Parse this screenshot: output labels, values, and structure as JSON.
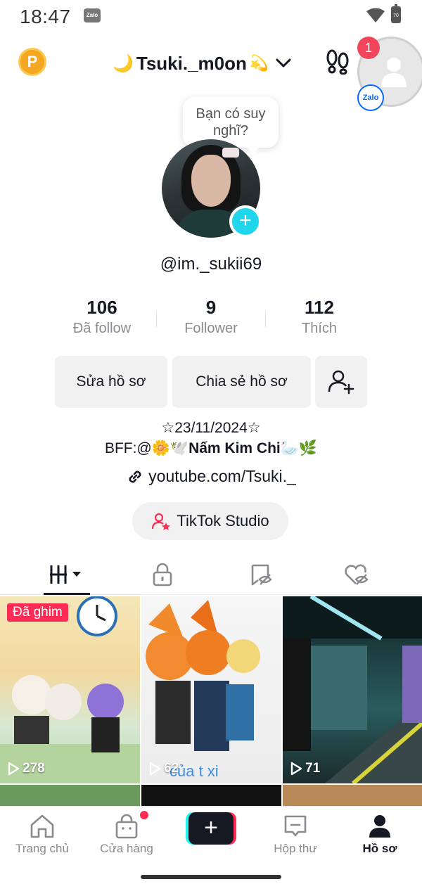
{
  "status_bar": {
    "time": "18:47",
    "app_chip": "Zalo",
    "battery": "70"
  },
  "header": {
    "points_label": "P",
    "username": "Tsuki._m0on",
    "username_prefix_emoji": "🌙",
    "username_suffix_emoji": "💫"
  },
  "zalo_bubble": {
    "notification_count": "1",
    "chip_label": "Zalo"
  },
  "profile": {
    "thought_bubble": "Bạn có suy nghĩ?",
    "handle": "@im._sukii69",
    "stats": [
      {
        "value": "106",
        "label": "Đã follow"
      },
      {
        "value": "9",
        "label": "Follower"
      },
      {
        "value": "112",
        "label": "Thích"
      }
    ],
    "buttons": {
      "edit": "Sửa hồ sơ",
      "share": "Chia sẻ hồ sơ"
    },
    "bio": {
      "line1": "☆23/11/2024☆",
      "line2_prefix": "BFF:@",
      "line2_emoji1": "🌼🕊️",
      "line2_name": "Nấm Kim Chi",
      "line2_emoji2": "🦢🌿",
      "link": "youtube.com/Tsuki._"
    },
    "studio_label": "TikTok Studio"
  },
  "videos": [
    {
      "pinned": true,
      "pinned_label": "Đã ghim",
      "views": "278",
      "caption": ""
    },
    {
      "pinned": false,
      "views": "62",
      "caption": "của t xi"
    },
    {
      "pinned": false,
      "views": "71",
      "caption": ""
    }
  ],
  "bottom_nav": [
    {
      "label": "Trang chủ",
      "icon": "home-icon",
      "active": false
    },
    {
      "label": "Cửa hàng",
      "icon": "shop-icon",
      "active": false
    },
    {
      "label": "Hộp thư",
      "icon": "inbox-icon",
      "active": false
    },
    {
      "label": "Hồ sơ",
      "icon": "profile-icon",
      "active": true
    }
  ],
  "colors": {
    "accent_pink": "#fe2c55",
    "accent_cyan": "#25f4ee",
    "text_primary": "#161823",
    "text_secondary": "#8a8b91"
  }
}
